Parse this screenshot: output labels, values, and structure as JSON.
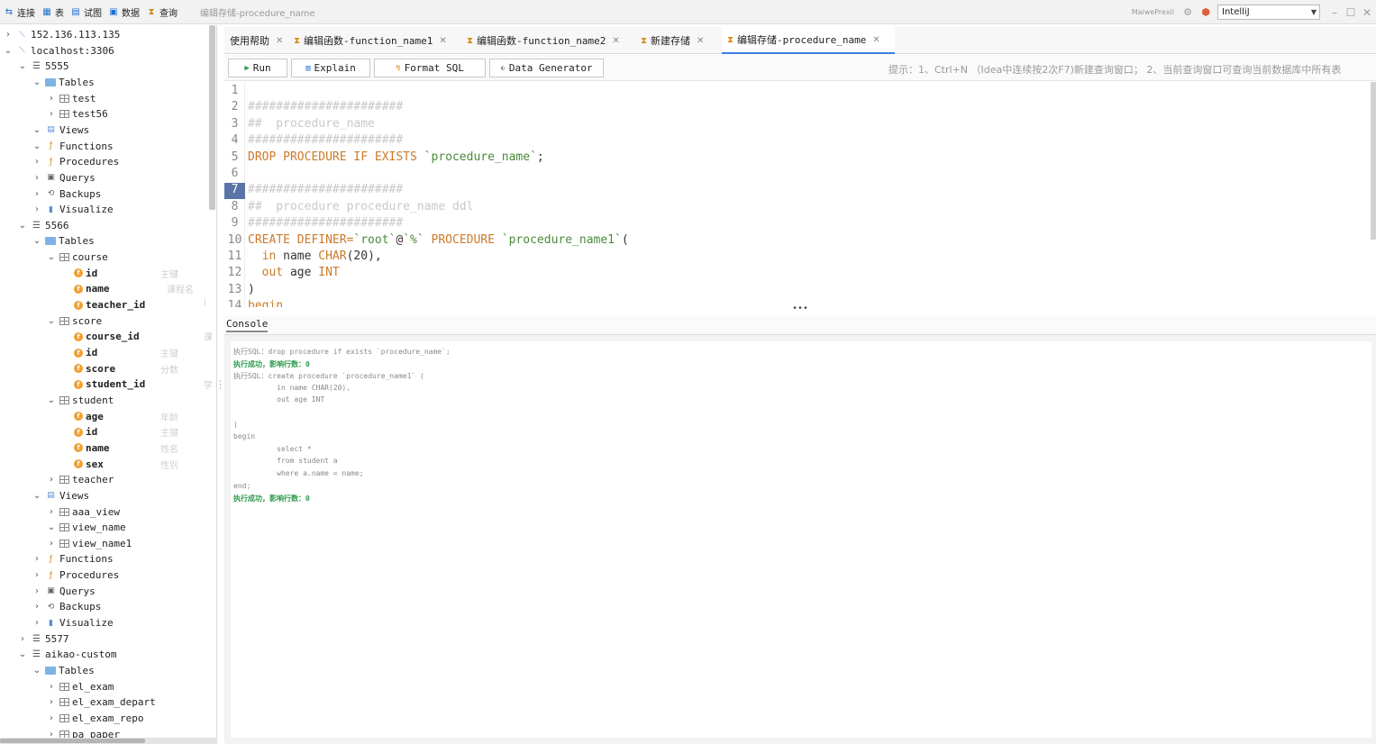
{
  "toolbar": {
    "connect": "连接",
    "table": "表",
    "view": "试图",
    "data": "数据",
    "query": "查询",
    "window_title": "编辑存储-procedure_name"
  },
  "top_right": {
    "brand": "MaiwePrexil",
    "theme_value": "IntelliJ"
  },
  "sidebar": {
    "rows": [
      {
        "chev": "›",
        "icon": "server",
        "label": "152.136.113.135",
        "level": 0
      },
      {
        "chev": "⌄",
        "icon": "server",
        "label": "localhost:3306",
        "level": 0
      },
      {
        "chev": "⌄",
        "icon": "db",
        "label": "5555",
        "level": 1
      },
      {
        "chev": "⌄",
        "icon": "folder",
        "label": "Tables",
        "level": 2
      },
      {
        "chev": "›",
        "icon": "table",
        "label": "test",
        "level": 3
      },
      {
        "chev": "›",
        "icon": "table",
        "label": "test56",
        "level": 3
      },
      {
        "chev": "⌄",
        "icon": "view",
        "label": "Views",
        "level": 2
      },
      {
        "chev": "⌄",
        "icon": "func",
        "label": "Functions",
        "level": 2
      },
      {
        "chev": "›",
        "icon": "func",
        "label": "Procedures",
        "level": 2
      },
      {
        "chev": "›",
        "icon": "query",
        "label": "Querys",
        "level": 2
      },
      {
        "chev": "›",
        "icon": "backup",
        "label": "Backups",
        "level": 2
      },
      {
        "chev": "›",
        "icon": "visual",
        "label": "Visualize",
        "level": 2
      },
      {
        "chev": "⌄",
        "icon": "db",
        "label": "5566",
        "level": 1
      },
      {
        "chev": "⌄",
        "icon": "folder",
        "label": "Tables",
        "level": 2
      },
      {
        "chev": "⌄",
        "icon": "table",
        "label": "course",
        "level": 3
      },
      {
        "chev": "",
        "icon": "field",
        "label": "id",
        "level": 4,
        "comment": "主键"
      },
      {
        "chev": "",
        "icon": "field",
        "label": "name",
        "level": 4,
        "comment": "课程名"
      },
      {
        "chev": "",
        "icon": "field",
        "label": "teacher_id",
        "level": 4,
        "comment": "i"
      },
      {
        "chev": "⌄",
        "icon": "table",
        "label": "score",
        "level": 3
      },
      {
        "chev": "",
        "icon": "field",
        "label": "course_id",
        "level": 4,
        "comment": "课"
      },
      {
        "chev": "",
        "icon": "field",
        "label": "id",
        "level": 4,
        "comment": "主键"
      },
      {
        "chev": "",
        "icon": "field",
        "label": "score",
        "level": 4,
        "comment": "分数"
      },
      {
        "chev": "",
        "icon": "field",
        "label": "student_id",
        "level": 4,
        "comment": "学"
      },
      {
        "chev": "⌄",
        "icon": "table",
        "label": "student",
        "level": 3
      },
      {
        "chev": "",
        "icon": "field",
        "label": "age",
        "level": 4,
        "comment": "年龄"
      },
      {
        "chev": "",
        "icon": "field",
        "label": "id",
        "level": 4,
        "comment": "主键"
      },
      {
        "chev": "",
        "icon": "field",
        "label": "name",
        "level": 4,
        "comment": "姓名"
      },
      {
        "chev": "",
        "icon": "field",
        "label": "sex",
        "level": 4,
        "comment": "性别"
      },
      {
        "chev": "›",
        "icon": "table",
        "label": "teacher",
        "level": 3
      },
      {
        "chev": "⌄",
        "icon": "view",
        "label": "Views",
        "level": 2
      },
      {
        "chev": "›",
        "icon": "table",
        "label": "aaa_view",
        "level": 3
      },
      {
        "chev": "⌄",
        "icon": "table",
        "label": "view_name",
        "level": 3
      },
      {
        "chev": "›",
        "icon": "table",
        "label": "view_name1",
        "level": 3
      },
      {
        "chev": "›",
        "icon": "func",
        "label": "Functions",
        "level": 2
      },
      {
        "chev": "›",
        "icon": "func",
        "label": "Procedures",
        "level": 2
      },
      {
        "chev": "›",
        "icon": "query",
        "label": "Querys",
        "level": 2
      },
      {
        "chev": "›",
        "icon": "backup",
        "label": "Backups",
        "level": 2
      },
      {
        "chev": "›",
        "icon": "visual",
        "label": "Visualize",
        "level": 2
      },
      {
        "chev": "›",
        "icon": "db",
        "label": "5577",
        "level": 1
      },
      {
        "chev": "⌄",
        "icon": "db",
        "label": "aikao-custom",
        "level": 1
      },
      {
        "chev": "⌄",
        "icon": "folder",
        "label": "Tables",
        "level": 2
      },
      {
        "chev": "›",
        "icon": "table",
        "label": "el_exam",
        "level": 3
      },
      {
        "chev": "›",
        "icon": "table",
        "label": "el_exam_depart",
        "level": 3
      },
      {
        "chev": "›",
        "icon": "table",
        "label": "el_exam_repo",
        "level": 3
      },
      {
        "chev": "›",
        "icon": "table",
        "label": "pa_paper",
        "level": 3
      }
    ]
  },
  "tabs": [
    {
      "label": "使用帮助",
      "icon": false,
      "active": false
    },
    {
      "label": "编辑函数-function_name1",
      "icon": true,
      "active": false
    },
    {
      "label": "编辑函数-function_name2",
      "icon": true,
      "active": false
    },
    {
      "label": "新建存储",
      "icon": true,
      "active": false
    },
    {
      "label": "编辑存储-procedure_name",
      "icon": true,
      "active": true
    }
  ],
  "sql_toolbar": {
    "run": "Run",
    "explain": "Explain",
    "format": "Format SQL",
    "generator": "Data Generator",
    "hint": "提示：1、Ctrl+N （Idea中连续按2次F7)新建查询窗口；  2、当前查询窗口可查询当前数据库中所有表"
  },
  "editor": {
    "current_line": 7,
    "lines": [
      [],
      [
        [
          "c-cmt",
          "######################"
        ]
      ],
      [
        [
          "c-cmt",
          "##  procedure_name"
        ]
      ],
      [
        [
          "c-cmt",
          "######################"
        ]
      ],
      [
        [
          "c-kw",
          "DROP PROCEDURE IF EXISTS "
        ],
        [
          "c-str",
          "`procedure_name`"
        ],
        [
          "c-pl",
          ";"
        ]
      ],
      [],
      [
        [
          "c-cmt",
          "######################"
        ]
      ],
      [
        [
          "c-cmt",
          "##  procedure procedure_name ddl"
        ]
      ],
      [
        [
          "c-cmt",
          "######################"
        ]
      ],
      [
        [
          "c-kw",
          "CREATE DEFINER="
        ],
        [
          "c-str",
          "`root`"
        ],
        [
          "c-pl",
          "@"
        ],
        [
          "c-str",
          "`%`"
        ],
        [
          "c-kw",
          " PROCEDURE "
        ],
        [
          "c-str",
          "`procedure_name1`"
        ],
        [
          "c-pl",
          "("
        ]
      ],
      [
        [
          "c-kw",
          "  in "
        ],
        [
          "c-pl",
          "name "
        ],
        [
          "c-kw",
          "CHAR"
        ],
        [
          "c-pl",
          "(20),"
        ]
      ],
      [
        [
          "c-kw",
          "  out "
        ],
        [
          "c-pl",
          "age "
        ],
        [
          "c-kw",
          "INT"
        ]
      ],
      [
        [
          "c-pl",
          ")"
        ]
      ],
      [
        [
          "c-kw",
          "begin"
        ]
      ]
    ]
  },
  "console": {
    "tab_label": "Console",
    "lines": [
      {
        "cls": "",
        "text": "执行SQL：drop procedure if exists `procedure_name`;"
      },
      {
        "cls": "ok",
        "text": "执行成功，影响行数：0"
      },
      {
        "cls": "",
        "text": "执行SQL：create procedure `procedure_name1` ("
      },
      {
        "cls": "",
        "text": "          in name CHAR(20),"
      },
      {
        "cls": "",
        "text": "          out age INT"
      },
      {
        "cls": "",
        "text": ""
      },
      {
        "cls": "",
        "text": ")"
      },
      {
        "cls": "",
        "text": "begin"
      },
      {
        "cls": "",
        "text": "          select *"
      },
      {
        "cls": "",
        "text": "          from student a"
      },
      {
        "cls": "",
        "text": "          where a.name = name;"
      },
      {
        "cls": "",
        "text": "end;"
      },
      {
        "cls": "ok",
        "text": "执行成功，影响行数：0"
      }
    ]
  }
}
